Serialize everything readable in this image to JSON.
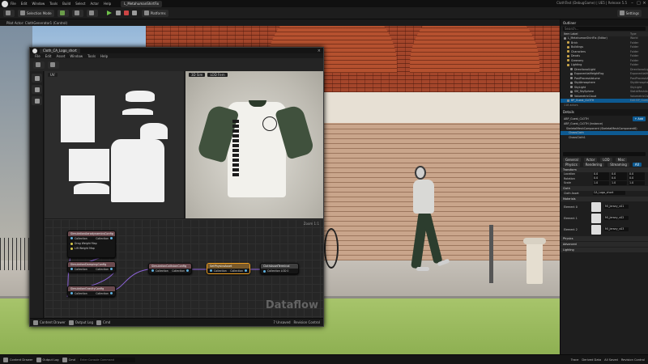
{
  "menubar": {
    "items": [
      "File",
      "Edit",
      "Window",
      "Tools",
      "Build",
      "Select",
      "Actor",
      "Help"
    ],
    "project_tab": "L_MetahumanShirtFix",
    "window_title": "ClothTest (DebugGame) | UE5 | Release 5.5"
  },
  "toolbar": {
    "selection_mode": "Selection Mode",
    "platforms": "Platforms",
    "settings": "Settings"
  },
  "viewport": {
    "tab_label": "Pilot Actor: ClothGenerator1 (Control)"
  },
  "dataflow": {
    "title_tab": "Cloth_CA_Logo_short",
    "menu": [
      "File",
      "Edit",
      "Asset",
      "Window",
      "Tools",
      "Help"
    ],
    "uv_header": "UV",
    "mesh_header_1": "3D Sim",
    "mesh_header_2": "LOD Fern",
    "zoom": "Zoom 1:1",
    "watermark": "Dataflow",
    "nodes": {
      "n1": {
        "title": "SimulationAerodynamicsConfig",
        "in": "Collection",
        "out": "Collection",
        "extra1": "Drag Weight Map",
        "extra2": "Lift Weight Map"
      },
      "n2": {
        "title": "SimulationDampingConfig",
        "in": "Collection",
        "out": "Collection"
      },
      "n3": {
        "title": "SimulationGravityConfig",
        "in": "Collection",
        "out": "Collection"
      },
      "n4": {
        "title": "SimulationCollisionConfig",
        "in": "Collection",
        "out": "Collection"
      },
      "n5": {
        "title": "SetPhysicsAsset",
        "in": "Collection",
        "out": "Collection"
      },
      "n6": {
        "title": "ClothAssetTerminal",
        "in": "Collection LOD 0"
      }
    },
    "status": {
      "content_drawer": "Content Drawer",
      "output_log": "Output Log",
      "cmd": "Cmd",
      "unsaved": "7 Unsaved",
      "revision": "Revision Control"
    }
  },
  "outliner": {
    "title": "Outliner",
    "search": "Search...",
    "col_label": "Item Label",
    "col_type": "Type",
    "rows": [
      {
        "label": "L_MetahumanShirtFix (Editor)",
        "type": "World"
      },
      {
        "label": "Brick",
        "type": "Folder"
      },
      {
        "label": "Buildings",
        "type": "Folder"
      },
      {
        "label": "Characters",
        "type": "Folder"
      },
      {
        "label": "Decals",
        "type": "Folder"
      },
      {
        "label": "Greenery",
        "type": "Folder"
      },
      {
        "label": "Lighting",
        "type": "Folder"
      },
      {
        "label": "DirectionalLight",
        "type": "DirectionalLight"
      },
      {
        "label": "ExponentialHeightFog",
        "type": "ExponentialHeightFog"
      },
      {
        "label": "PostProcessVolume",
        "type": "PostProcessVolume"
      },
      {
        "label": "SkyAtmosphere",
        "type": "SkyAtmosphere"
      },
      {
        "label": "SkyLight",
        "type": "SkyLight"
      },
      {
        "label": "SM_SkySphere",
        "type": "StaticMeshActor"
      },
      {
        "label": "VolumetricCloud",
        "type": "VolumetricCloud"
      },
      {
        "label": "BP_Guest_CLOTH",
        "type": "Edit BP_Guest"
      }
    ],
    "footer": "118 actors"
  },
  "details": {
    "title": "Details",
    "actor": "ABP_Guest_CLOTH",
    "add": "+ Add",
    "components": [
      "ABP_Guest_CLOTH (Instance)",
      "SkeletalMeshComponent (SkeletalMeshComponent0)",
      "ChaosCloth",
      "ChaosCloth1"
    ],
    "filter_tabs": [
      "General",
      "Actor",
      "LOD",
      "Misc",
      "Physics",
      "Rendering",
      "Streaming",
      "All"
    ],
    "sections": {
      "transform": "Transform",
      "location": "Location",
      "rotation": "Rotation",
      "scale": "Scale",
      "cloth": "Cloth",
      "cloth_asset": "Cloth Asset",
      "cloth_asset_value": "CA_Logo_short",
      "materials": "Materials",
      "element0": "Element 0",
      "element1": "Element 1",
      "element2": "Element 2",
      "mat0": "MI_Jersey_v01",
      "mat1": "MI_Jersey_v02",
      "mat2": "MI_Jersey_v03",
      "physics": "Physics",
      "advanced": "Advanced",
      "lighting": "Lighting"
    },
    "vals": {
      "loc_x": "0.0",
      "loc_y": "0.0",
      "loc_z": "0.0",
      "rot_x": "0.0",
      "rot_y": "0.0",
      "rot_z": "0.0",
      "sc_x": "1.0",
      "sc_y": "1.0",
      "sc_z": "1.0"
    }
  },
  "statusbar": {
    "content_drawer": "Content Drawer",
    "output_log": "Output Log",
    "cmd": "Cmd",
    "cmd_placeholder": "Enter Console Command",
    "trace": "Trace",
    "derived_data": "Derived Data",
    "unsaved": "All Saved",
    "revision": "Revision Control"
  }
}
